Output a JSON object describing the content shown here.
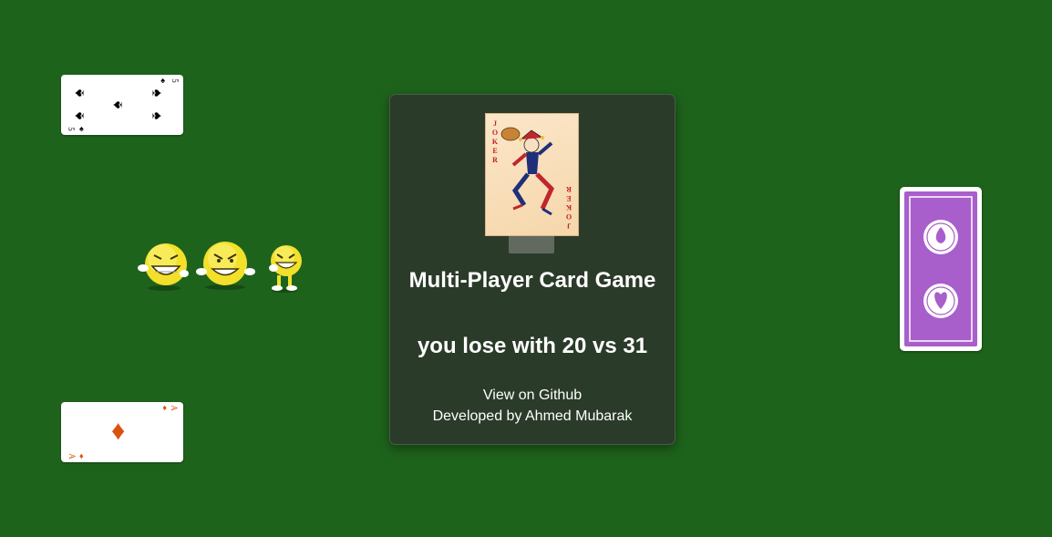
{
  "modal": {
    "title": "Multi-Player Card Game",
    "result": "you lose with 20 vs 31",
    "github_link": "View on Github",
    "credit": "Developed by Ahmed Mubarak"
  },
  "cards": {
    "top_left": {
      "rank": "5",
      "suit": "spades",
      "suit_glyph": "♠"
    },
    "bottom_left": {
      "rank": "A",
      "suit": "diamonds",
      "suit_glyph": "♦"
    },
    "modal_card": {
      "name": "Joker",
      "letters": "JOKER"
    },
    "right_card": {
      "face": "back"
    }
  },
  "colors": {
    "table": "#1e631c",
    "modal_bg": "#2a3b29",
    "card_back": "#a85ecb",
    "diamond_red": "#d9530e"
  },
  "icons": [
    "laughing-emoji-icon",
    "grinning-emoji-icon",
    "laughing-emoji-icon"
  ]
}
